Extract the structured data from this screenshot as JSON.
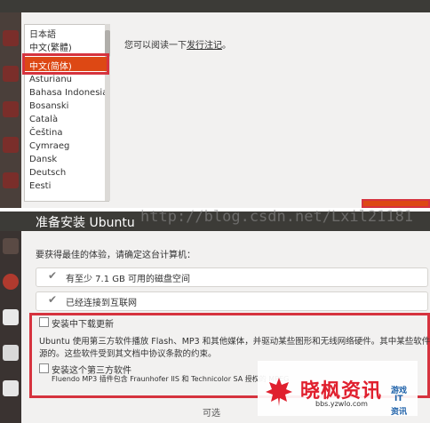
{
  "language_list": {
    "items_above": [
      "日本語",
      "中文(繁體)"
    ],
    "selected": "中文(简体)",
    "items_below": [
      "Asturianu",
      "Bahasa Indonesia",
      "Bosanski",
      "Català",
      "Čeština",
      "Cymraeg",
      "Dansk",
      "Deutsch",
      "Eesti"
    ]
  },
  "release_notes": {
    "prefix": "您可以阅读一下",
    "link": "发行注记",
    "suffix": "。"
  },
  "prepare": {
    "title": "准备安装 Ubuntu",
    "intro": "要获得最佳的体验，请确定这台计算机：",
    "requirements": [
      "有至少 7.1 GB 可用的磁盘空间",
      "已经连接到互联网"
    ],
    "download_updates_label": "安装中下载更新",
    "description_line1": "Ubuntu 使用第三方软件播放 Flash、MP3 和其他媒体，并驱动某些图形和无线网络硬件。其中某些软件是闭",
    "description_line2": "源的。这些软件受到其文档中协议条款的约束。",
    "third_party_label": "安装这个第三方软件",
    "fluendo_note": "Fluendo MP3 插件包含 Fraunhofer IIS 和 Technicolor SA 授权的 MPEG",
    "optional_label": "可选"
  },
  "watermarks": {
    "url": "http://blog.csdn.net/Lxil21181",
    "logo_text": "晓枫资讯",
    "logo_site": "bbs.yzwlo.com",
    "logo_side": [
      "游戏",
      "IT",
      "资讯"
    ]
  },
  "colors": {
    "accent": "#dd4814",
    "highlight_box": "#d6333e",
    "logo_red": "#e0202e"
  }
}
